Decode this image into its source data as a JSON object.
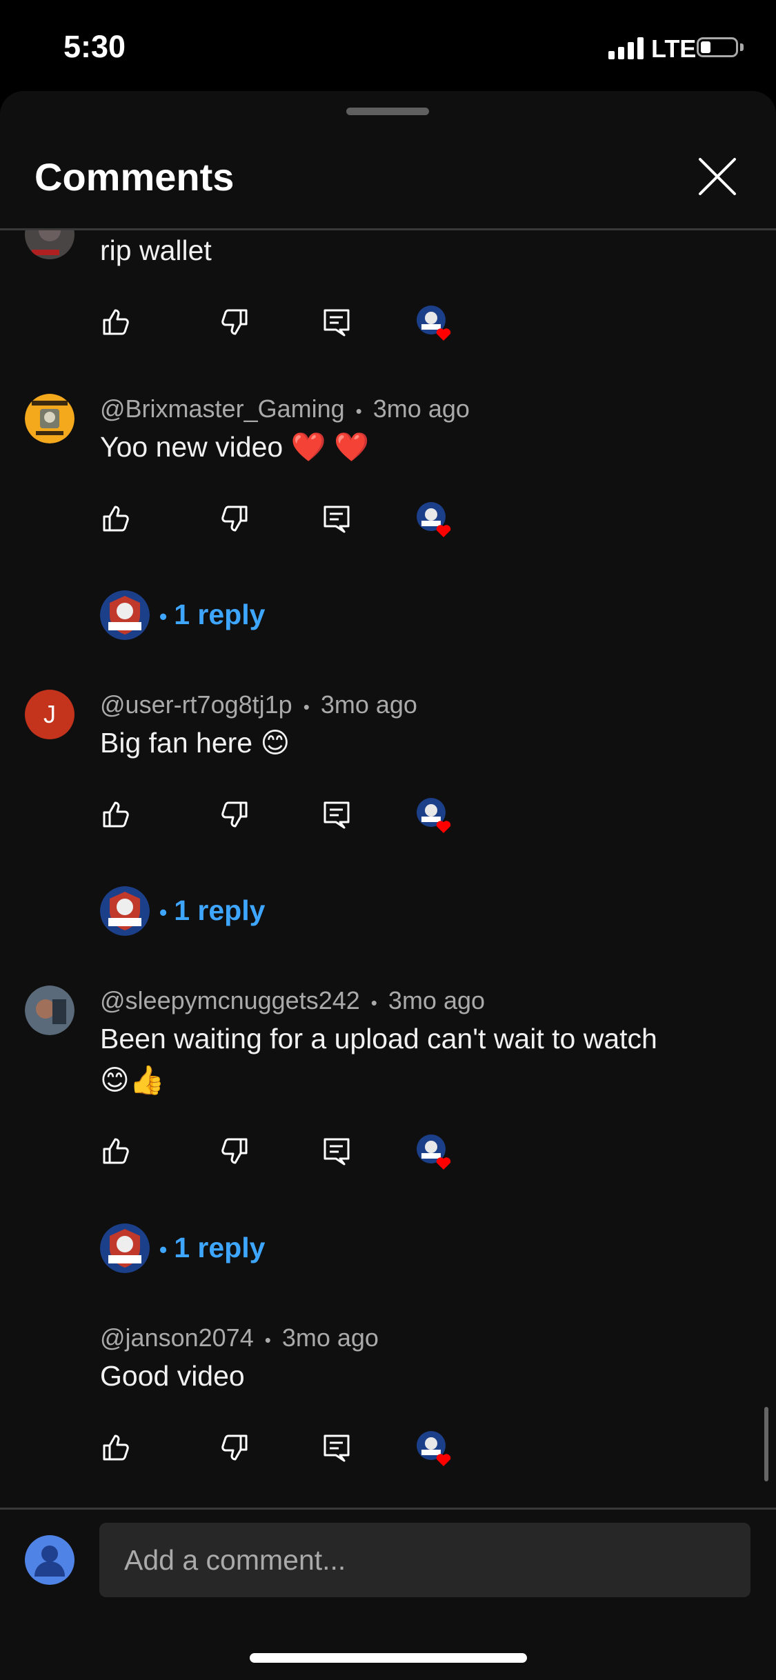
{
  "status_bar": {
    "time": "5:30",
    "network": "LTE"
  },
  "sheet": {
    "title": "Comments"
  },
  "comments": [
    {
      "author": "",
      "age": "",
      "text": "rip wallet"
    },
    {
      "author": "@Brixmaster_Gaming",
      "age": "3mo ago",
      "text": "Yoo new video ❤️ ❤️",
      "replies": "1 reply"
    },
    {
      "author": "@user-rt7og8tj1p",
      "age": "3mo ago",
      "text": "Big fan here 😊",
      "avatar_letter": "J",
      "replies": "1 reply"
    },
    {
      "author": "@sleepymcnuggets242",
      "age": "3mo ago",
      "text_line1": "Been waiting for a upload can't wait to watch",
      "text_line2": "😊👍",
      "replies": "1 reply"
    },
    {
      "author": "@janson2074",
      "age": "3mo ago",
      "text": "Good video"
    }
  ],
  "reply_prefix": "•",
  "input": {
    "placeholder": "Add a comment..."
  },
  "colors": {
    "background": "#0f0f0f",
    "reply_link": "#3ea6ff",
    "secondary_text": "#aaaaaa",
    "heart": "#ff0000"
  },
  "icons": {
    "like": "thumbs-up-icon",
    "dislike": "thumbs-down-icon",
    "reply": "reply-icon",
    "creator_heart": "creator-heart-icon",
    "close": "close-icon"
  }
}
